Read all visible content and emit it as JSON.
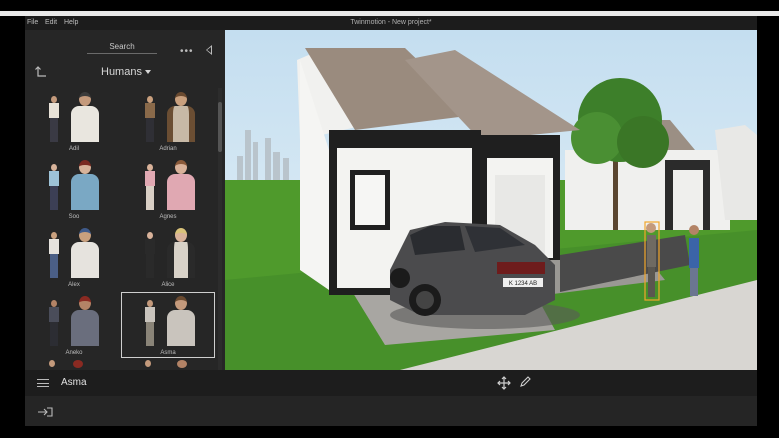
{
  "app": {
    "window_title": "Twinmotion - New project*",
    "menu": [
      "File",
      "Edit",
      "Help"
    ]
  },
  "library": {
    "search_label": "Search",
    "category": "Humans",
    "items": [
      {
        "name": "Adil",
        "colors": [
          "#e8e2d8",
          "#e9e6df",
          "#3a3a44"
        ]
      },
      {
        "name": "Adrian",
        "colors": [
          "#8a6a4a",
          "#c7b9a6",
          "#2f2f35"
        ]
      },
      {
        "name": "Soo",
        "colors": [
          "#9ec3d8",
          "#7aa8c4",
          "#3c3f55"
        ]
      },
      {
        "name": "Agnes",
        "colors": [
          "#e0a8b2",
          "#e0a8b2",
          "#d9cfc4"
        ]
      },
      {
        "name": "Alex",
        "colors": [
          "#e6e3de",
          "#e6e3de",
          "#4b5f86"
        ]
      },
      {
        "name": "Alice",
        "colors": [
          "#2a2a2a",
          "#d8d2c8",
          "#2a2a2a"
        ]
      },
      {
        "name": "Aneko",
        "colors": [
          "#4a4d5a",
          "#6a6e7d",
          "#2c2d33"
        ]
      },
      {
        "name": "Asma",
        "colors": [
          "#c9c4bd",
          "#c9c4bd",
          "#8a8478"
        ]
      }
    ],
    "selected": "Asma"
  },
  "selection_bar": {
    "selected_name": "Asma"
  },
  "viewport": {
    "sky_color": "#cfe6f4",
    "grass_color": "#4f9a2c",
    "road_color": "#d8d6d2",
    "car_plate": "K 1234 AB"
  }
}
